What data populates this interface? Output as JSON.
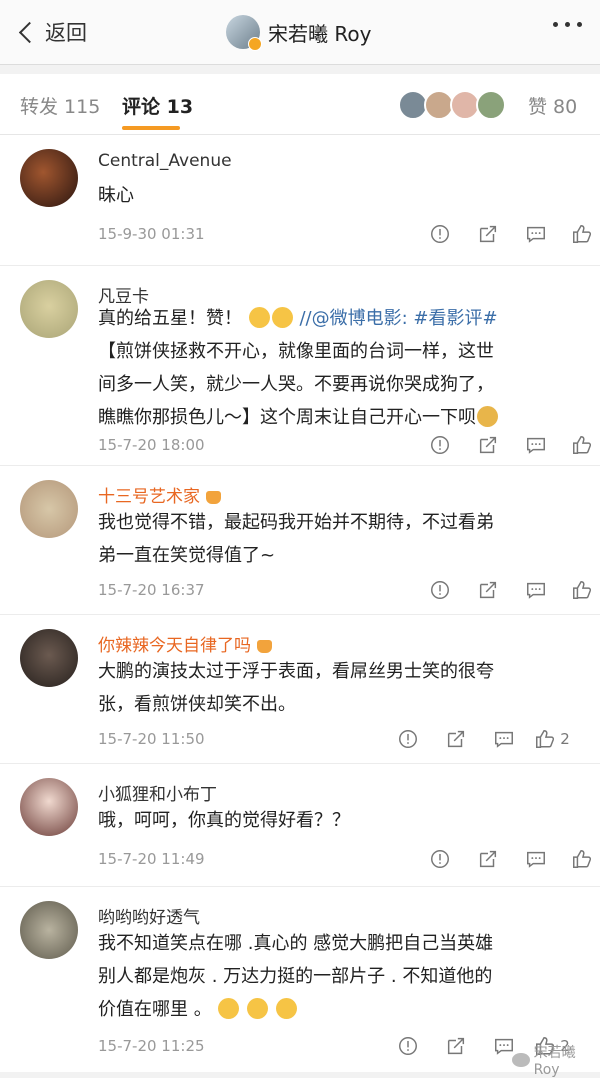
{
  "nav": {
    "back_label": "返回",
    "title": "宋若曦 Roy"
  },
  "tabs": {
    "repost": "转发 115",
    "comments": "评论 13",
    "likes": "赞 80"
  },
  "comments": [
    {
      "name": "Central_Avenue",
      "name_style": "normal",
      "lines": [
        "昧心"
      ],
      "time": "15-9-30 01:31",
      "likes": ""
    },
    {
      "name": "凡豆卡",
      "name_style": "normal",
      "lines": [
        "真的给五星！赞！",
        "【煎饼侠拯救不开心，就像里面的台词一样，这世",
        "间多一人笑，就少一人哭。不要再说你哭成狗了，",
        "瞧瞧你那损色儿～】这个周末让自己开心一下呗"
      ],
      "link": "//@微博电影: #看影评#",
      "time": "15-7-20 18:00",
      "likes": ""
    },
    {
      "name": "十三号艺术家",
      "name_style": "orange",
      "lines": [
        "我也觉得不错，最起码我开始并不期待，不过看弟",
        "弟一直在笑觉得值了~"
      ],
      "time": "15-7-20 16:37",
      "likes": ""
    },
    {
      "name": "你辣辣今天自律了吗",
      "name_style": "orange",
      "lines": [
        "大鹏的演技太过于浮于表面，看屌丝男士笑的很夸",
        "张，看煎饼侠却笑不出。"
      ],
      "time": "15-7-20 11:50",
      "likes": "2"
    },
    {
      "name": "小狐狸和小布丁",
      "name_style": "normal",
      "lines": [
        "哦，呵呵，你真的觉得好看？？"
      ],
      "time": "15-7-20 11:49",
      "likes": ""
    },
    {
      "name": "哟哟哟好透气",
      "name_style": "normal",
      "lines": [
        "我不知道笑点在哪 .真心的 感觉大鹏把自己当英雄",
        "别人都是炮灰 . 万达力挺的一部片子 . 不知道他的",
        "价值在哪里 。"
      ],
      "time": "15-7-20 11:25",
      "likes": "2"
    }
  ],
  "watermark": "宋若曦Roy",
  "colors": {
    "accent": "#f59a23",
    "orange_name": "#e86722",
    "link": "#3b6ea8"
  }
}
